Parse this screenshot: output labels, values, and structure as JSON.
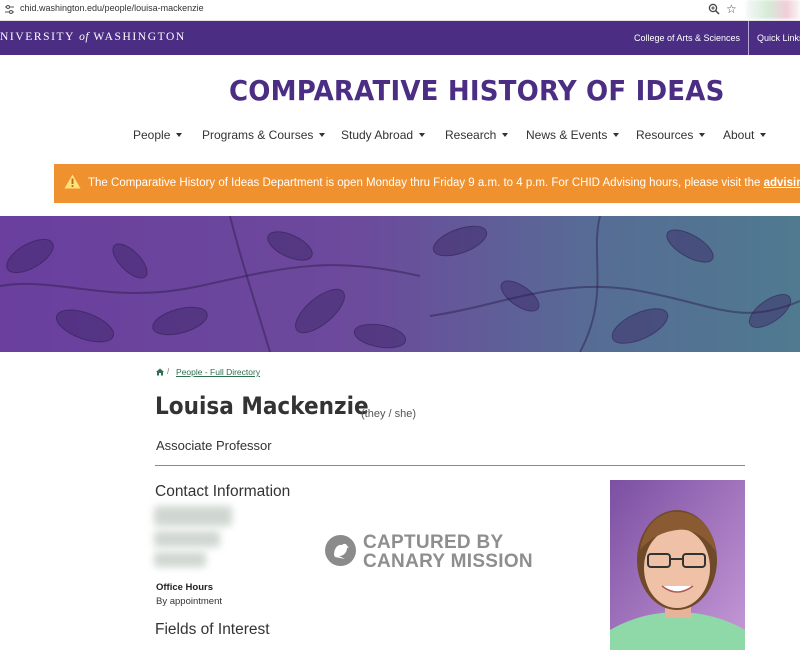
{
  "browser": {
    "url": "chid.washington.edu/people/louisa-mackenzie"
  },
  "uw_bar": {
    "wordmark_pre": "NIVERSITY",
    "wordmark_of": "of",
    "wordmark_post": "WASHINGTON",
    "college_link": "College of Arts & Sciences",
    "quick_links": "Quick Links"
  },
  "header": {
    "title": "COMPARATIVE HISTORY OF IDEAS",
    "nav": [
      "People",
      "Programs & Courses",
      "Study Abroad",
      "Research",
      "News & Events",
      "Resources",
      "About"
    ]
  },
  "alert": {
    "text": "The Comparative History of Ideas Department is open Monday thru Friday 9 a.m. to 4 p.m. For CHID Advising hours, please visit the",
    "link": "advising"
  },
  "breadcrumb": {
    "separator": "/",
    "link": "People - Full Directory"
  },
  "profile": {
    "name": "Louisa Mackenzie",
    "pronouns": "(they / she)",
    "title": "Associate Professor",
    "contact_heading": "Contact Information",
    "office_hours_label": "Office Hours",
    "office_hours_value": "By appointment",
    "fields_heading": "Fields of Interest"
  },
  "watermark": {
    "line1": "CAPTURED BY",
    "line2": "CANARY MISSION"
  },
  "colors": {
    "uw_purple": "#4b2e83",
    "alert_orange": "#f0912f",
    "link_green": "#2f6f4e"
  }
}
